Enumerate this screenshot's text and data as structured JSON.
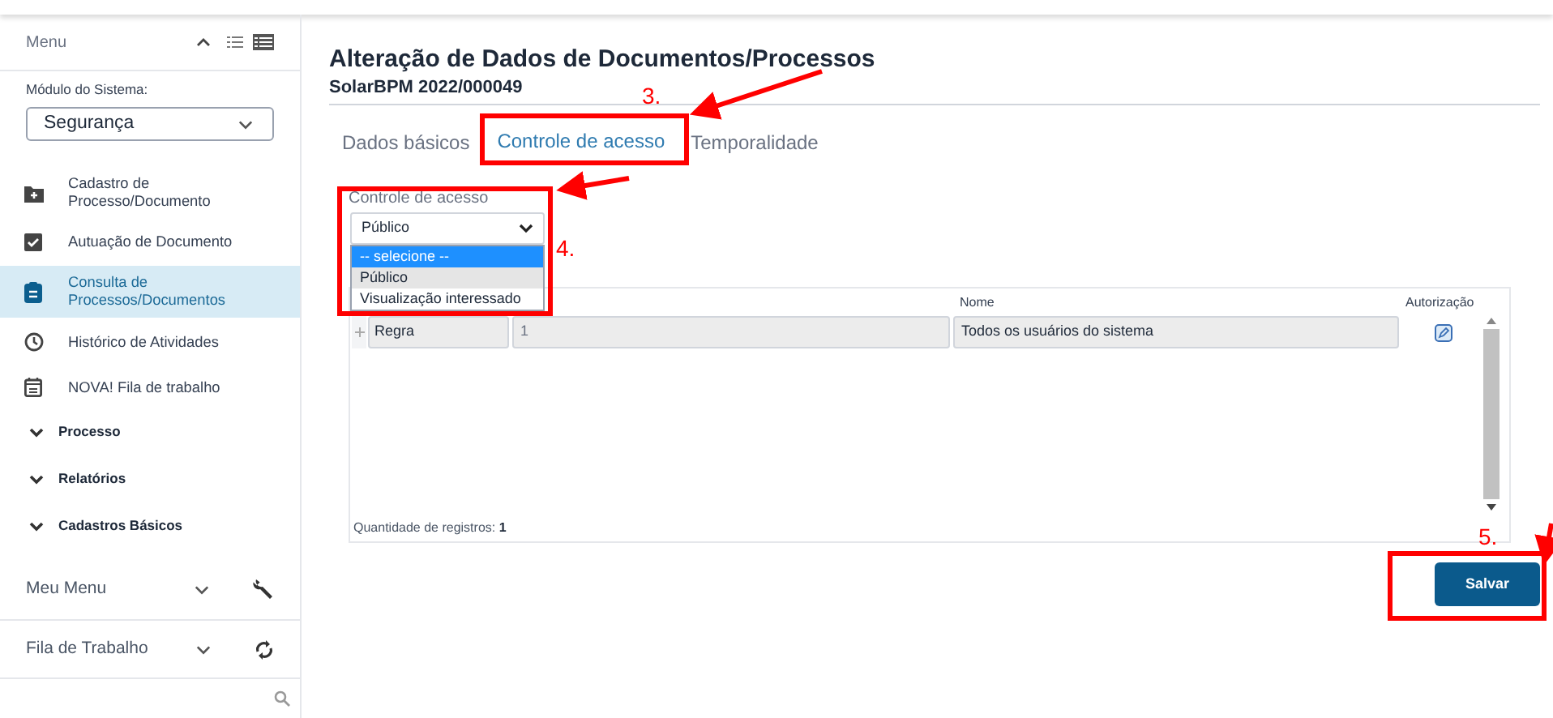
{
  "sidebar": {
    "title": "Menu",
    "module_label": "Módulo do Sistema:",
    "module_value": "Segurança",
    "items": [
      {
        "label": "Cadastro de Processo/Documento",
        "kind": "link",
        "selected": false
      },
      {
        "label": "Autuação de Documento",
        "kind": "link",
        "selected": false
      },
      {
        "label": "Consulta de Processos/Documentos",
        "kind": "link",
        "selected": true
      },
      {
        "label": "Histórico de Atividades",
        "kind": "link",
        "selected": false
      },
      {
        "label": "NOVA! Fila de trabalho",
        "kind": "link",
        "selected": false
      },
      {
        "label": "Processo",
        "kind": "group",
        "selected": false
      },
      {
        "label": "Relatórios",
        "kind": "group",
        "selected": false
      },
      {
        "label": "Cadastros Básicos",
        "kind": "group",
        "selected": false
      }
    ],
    "sections": [
      {
        "label": "Meu Menu"
      },
      {
        "label": "Fila de Trabalho"
      }
    ]
  },
  "page": {
    "title": "Alteração de Dados de Documentos/Processos",
    "subtitle": "SolarBPM 2022/000049"
  },
  "tabs": [
    {
      "label": "Dados básicos",
      "selected": false
    },
    {
      "label": "Controle de acesso",
      "selected": true
    },
    {
      "label": "Temporalidade",
      "selected": false
    }
  ],
  "access_control": {
    "label": "Controle de acesso",
    "value": "Público",
    "options": [
      {
        "label": "-- selecione --",
        "highlighted": true,
        "selected": false
      },
      {
        "label": "Público",
        "highlighted": false,
        "selected": true
      },
      {
        "label": "Visualização interessado",
        "highlighted": false,
        "selected": false
      }
    ]
  },
  "table": {
    "columns": [
      "Nome",
      "Autorização"
    ],
    "rows": [
      {
        "type": "Regra",
        "code": "1",
        "name": "Todos os usuários do sistema"
      }
    ],
    "count_label": "Quantidade de registros:",
    "count": "1"
  },
  "save_button": "Salvar",
  "annotations": [
    {
      "label": "3."
    },
    {
      "label": "4."
    },
    {
      "label": "5."
    }
  ]
}
